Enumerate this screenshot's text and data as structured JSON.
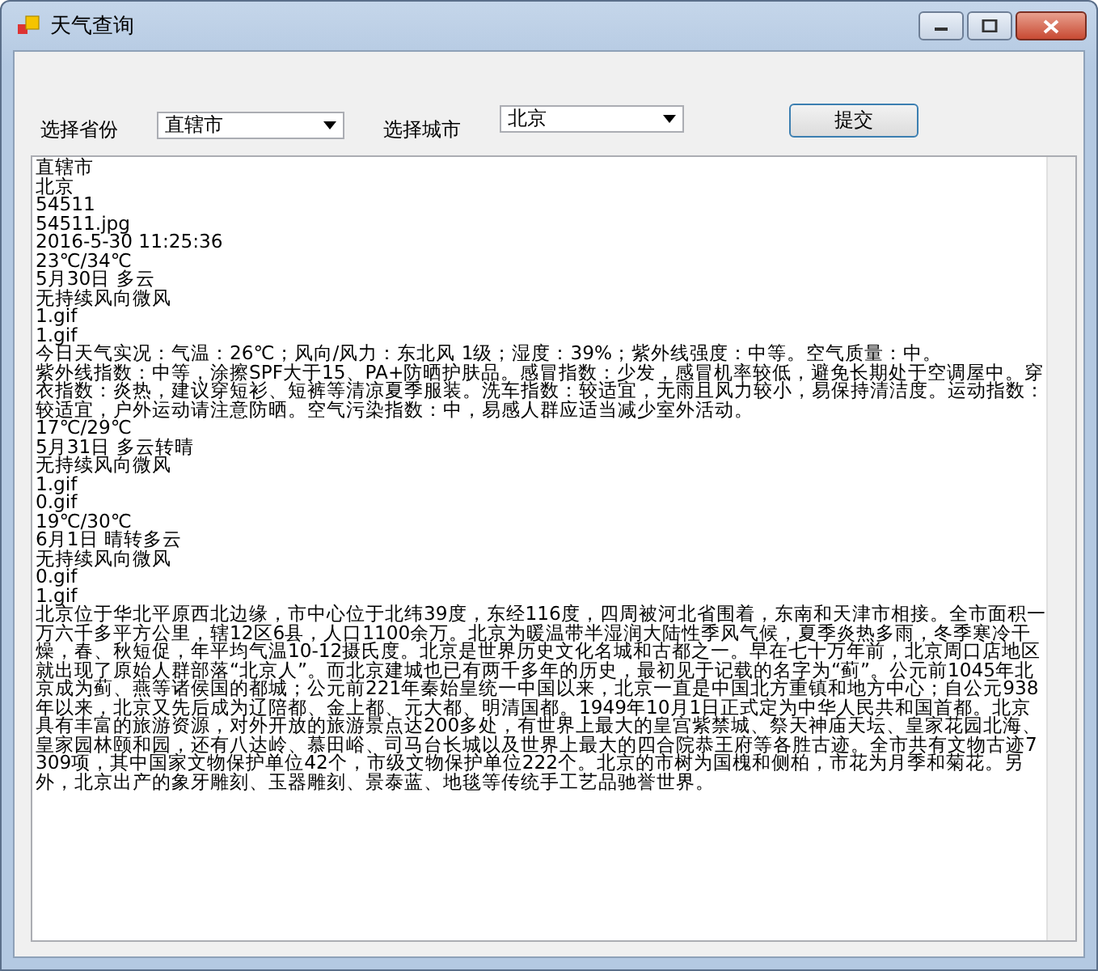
{
  "window": {
    "title": "天气查询"
  },
  "form": {
    "province_label": "选择省份",
    "province": "直辖市",
    "city_label": "选择城市",
    "city": "北京",
    "submit": "提交"
  },
  "output": {
    "lines": [
      "直辖市",
      "北京",
      "54511",
      "54511.jpg",
      "2016-5-30 11:25:36",
      "23℃/34℃",
      "5月30日 多云",
      "无持续风向微风",
      "1.gif",
      "1.gif",
      "今日天气实况：气温：26℃；风向/风力：东北风 1级；湿度：39%；紫外线强度：中等。空气质量：中。",
      "紫外线指数：中等，涂擦SPF大于15、PA+防晒护肤品。感冒指数：少发，感冒机率较低，避免长期处于空调屋中。穿衣指数：炎热，建议穿短衫、短裤等清凉夏季服装。洗车指数：较适宜，无雨且风力较小，易保持清洁度。运动指数：较适宜，户外运动请注意防晒。空气污染指数：中，易感人群应适当减少室外活动。",
      "17℃/29℃",
      "5月31日 多云转晴",
      "无持续风向微风",
      "1.gif",
      "0.gif",
      "19℃/30℃",
      "6月1日 晴转多云",
      "无持续风向微风",
      "0.gif",
      "1.gif",
      "北京位于华北平原西北边缘，市中心位于北纬39度，东经116度，四周被河北省围着，东南和天津市相接。全市面积一万六千多平方公里，辖12区6县，人口1100余万。北京为暖温带半湿润大陆性季风气候，夏季炎热多雨，冬季寒冷干燥，春、秋短促，年平均气温10-12摄氏度。北京是世界历史文化名城和古都之一。早在七十万年前，北京周口店地区就出现了原始人群部落“北京人”。而北京建城也已有两千多年的历史，最初见于记载的名字为“蓟”。公元前1045年北京成为蓟、燕等诸侯国的都城；公元前221年秦始皇统一中国以来，北京一直是中国北方重镇和地方中心；自公元938年以来，北京又先后成为辽陪都、金上都、元大都、明清国都。1949年10月1日正式定为中华人民共和国首都。北京具有丰富的旅游资源，对外开放的旅游景点达200多处，有世界上最大的皇宫紫禁城、祭天神庙天坛、皇家花园北海、皇家园林颐和园，还有八达岭、慕田峪、司马台长城以及世界上最大的四合院恭王府等各胜古迹。全市共有文物古迹7309项，其中国家文物保护单位42个，市级文物保护单位222个。北京的市树为国槐和侧柏，市花为月季和菊花。另外，北京出产的象牙雕刻、玉器雕刻、景泰蓝、地毯等传统手工艺品驰誉世界。"
    ]
  }
}
